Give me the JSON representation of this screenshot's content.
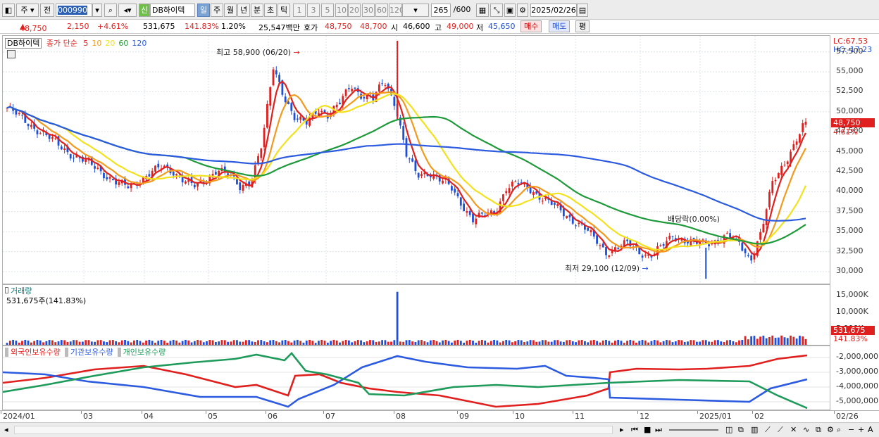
{
  "toolbar": {
    "mode": "주",
    "prefix": "전",
    "code": "000990",
    "name": "DB하이텍",
    "shin": "신",
    "periods": [
      "일",
      "주",
      "월",
      "년",
      "분",
      "초",
      "틱"
    ],
    "intervals": [
      "1",
      "3",
      "5",
      "10",
      "20",
      "30",
      "60",
      "120"
    ],
    "count": "265",
    "count_max": "/600",
    "date": "2025/02/26"
  },
  "quote": {
    "price": "48,750",
    "change": "2,150",
    "change_pct": "+4.61%",
    "volume": "531,675",
    "vol_ratio": "141.83%",
    "turnover": "1.20%",
    "amount": "25,547백만",
    "hoga_label": "호가",
    "ask": "48,750",
    "bid": "48,700",
    "open_label": "시",
    "open": "46,600",
    "high_label": "고",
    "high": "49,000",
    "low_label": "저",
    "low": "45,650",
    "buy_label": "매수",
    "sell_label": "매도",
    "eval_label": "평"
  },
  "main_chart": {
    "name": "DB하이텍",
    "legend_label": "종가 단순",
    "ma": [
      {
        "name": "5",
        "color": "#e0201e"
      },
      {
        "name": "10",
        "color": "#f39a1e"
      },
      {
        "name": "20",
        "color": "#f2e21e"
      },
      {
        "name": "60",
        "color": "#1e9a3a"
      },
      {
        "name": "120",
        "color": "#2c5be0"
      }
    ],
    "high_note": "최고 58,900 (06/20)",
    "low_note": "최저 29,100 (12/09)",
    "dividend_note": "배당락(0.00%)",
    "lc": "LC:67.53",
    "hc": "HC:-17.23",
    "y_ticks": [
      "57,500",
      "55,000",
      "52,500",
      "50,000",
      "47,500",
      "45,000",
      "42,500",
      "40,000",
      "37,500",
      "35,000",
      "32,500",
      "30,000"
    ],
    "current_price": "48,750",
    "current_pct": "4.61%",
    "colors": {
      "up": "#e0201e",
      "down": "#1f4fd8",
      "grid": "#dde3ec"
    }
  },
  "volume_chart": {
    "title": "거래량",
    "value": "531,675주(141.83%)",
    "y_ticks": [
      "15,000K",
      "10,000K",
      "5,000K"
    ],
    "current": "531,675",
    "current_pct": "141.83%"
  },
  "holdings_chart": {
    "legend": [
      {
        "name": "외국인보유수량",
        "color": "#e0201e"
      },
      {
        "name": "기관보유수량",
        "color": "#2c5be0"
      },
      {
        "name": "개인보유수량",
        "color": "#1e9a5a"
      }
    ],
    "y_ticks": [
      "-2,000,000",
      "-3,000,000",
      "-4,000,000",
      "-5,000,000"
    ]
  },
  "x_axis": [
    "2024/01",
    "03",
    "04",
    "05",
    "06",
    "07",
    "08",
    "09",
    "10",
    "11",
    "12",
    "2025/01",
    "02",
    "02/26"
  ],
  "chart_data": {
    "type": "candlestick",
    "title": "DB하이텍",
    "x_range": [
      "2024/01",
      "2025/02/26"
    ],
    "ylim": [
      28500,
      59500
    ],
    "close_approx": [
      50500,
      49500,
      48500,
      47500,
      46500,
      45500,
      44500,
      43800,
      43000,
      42000,
      41000,
      40500,
      41500,
      42500,
      43000,
      42500,
      41500,
      40500,
      41500,
      43000,
      42000,
      40500,
      41500,
      46000,
      55500,
      52000,
      49000,
      48500,
      50500,
      49500,
      51000,
      53500,
      52000,
      51500,
      54000,
      51000,
      44500,
      42000,
      42500,
      41500,
      40500,
      38500,
      36500,
      37000,
      37500,
      40500,
      41000,
      40500,
      39500,
      38500,
      37500,
      36500,
      35500,
      34000,
      32500,
      33000,
      33500,
      32500,
      32000,
      33000,
      34500,
      34000,
      33500,
      33500,
      34000,
      34500,
      33500,
      31500,
      35000,
      41000,
      43500,
      46000,
      48750
    ],
    "high": {
      "value": 58900,
      "date": "06/20"
    },
    "low": {
      "value": 29100,
      "date": "12/09"
    },
    "last": {
      "price": 48750,
      "change": 2150,
      "change_pct": 4.61,
      "open": 46600,
      "high": 49000,
      "low": 45650,
      "volume": 531675
    }
  }
}
